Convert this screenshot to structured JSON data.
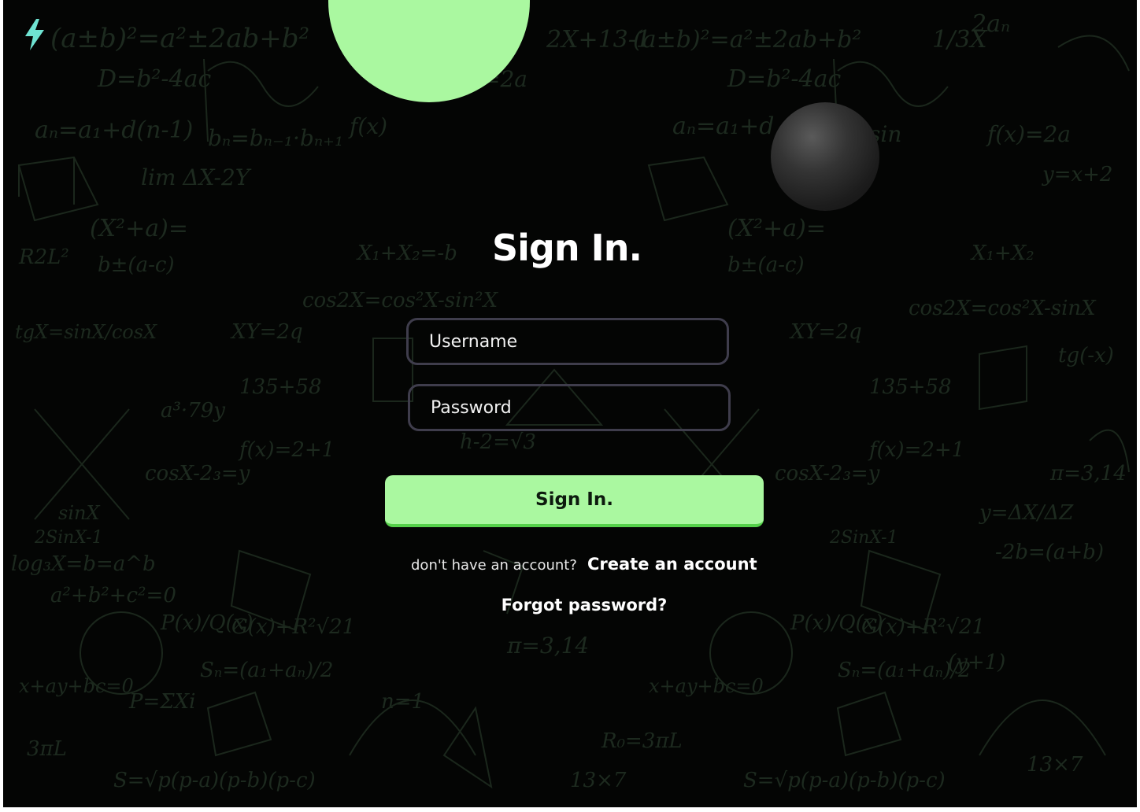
{
  "brand": {
    "logo_icon": "lightning-bolt-icon",
    "accent_color": "#aaf8a0",
    "logo_color": "#6fe3d2"
  },
  "signin": {
    "title": "Sign In.",
    "username_placeholder": "Username",
    "password_placeholder": "Password",
    "submit_label": "Sign In.",
    "no_account_text": "don't have an account?",
    "create_account_label": "Create an account",
    "forgot_password_label": "Forgot password?"
  },
  "background": {
    "color": "#040504",
    "pattern": "math formulas doodle"
  }
}
